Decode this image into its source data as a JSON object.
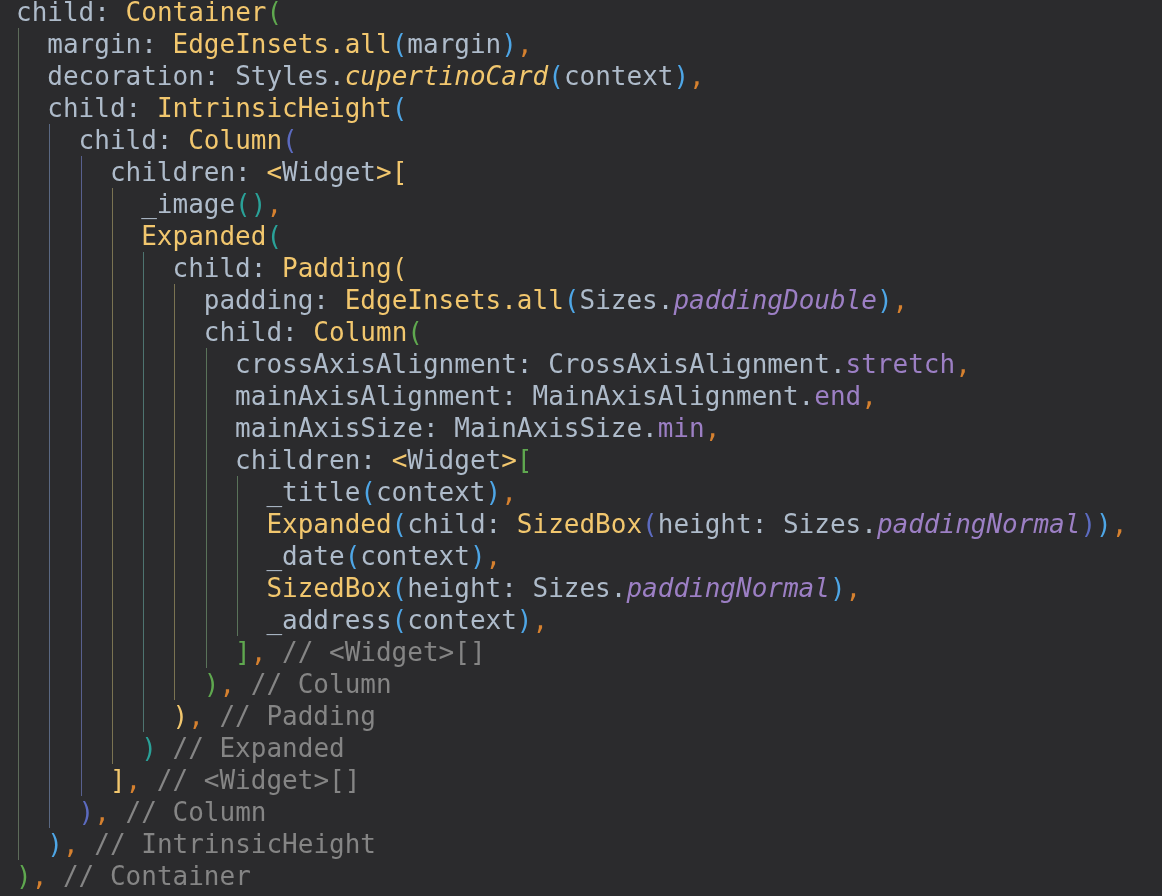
{
  "editor": {
    "lines": [
      {
        "tokens": [
          {
            "kind": "name",
            "text": "child: "
          },
          {
            "kind": "type",
            "text": "Container"
          },
          {
            "kind": "bracket",
            "text": "(",
            "color": "#5fa84f"
          }
        ],
        "children": [
          {
            "tokens": [
              {
                "kind": "name",
                "text": "margin: "
              },
              {
                "kind": "type",
                "text": "EdgeInsets.all"
              },
              {
                "kind": "bracket",
                "text": "(",
                "color": "#4ea6e6"
              },
              {
                "kind": "name",
                "text": "margin"
              },
              {
                "kind": "bracket",
                "text": ")",
                "color": "#4ea6e6"
              },
              {
                "kind": "comma",
                "text": ","
              }
            ]
          },
          {
            "tokens": [
              {
                "kind": "name",
                "text": "decoration: Styles."
              },
              {
                "kind": "static",
                "text": "cupertinoCard"
              },
              {
                "kind": "bracket",
                "text": "(",
                "color": "#4ea6e6"
              },
              {
                "kind": "name",
                "text": "context"
              },
              {
                "kind": "bracket",
                "text": ")",
                "color": "#4ea6e6"
              },
              {
                "kind": "comma",
                "text": ","
              }
            ]
          },
          {
            "tokens": [
              {
                "kind": "name",
                "text": "child: "
              },
              {
                "kind": "type",
                "text": "IntrinsicHeight"
              },
              {
                "kind": "bracket",
                "text": "(",
                "color": "#4ea6e6"
              }
            ],
            "children": [
              {
                "tokens": [
                  {
                    "kind": "name",
                    "text": "child: "
                  },
                  {
                    "kind": "type",
                    "text": "Column"
                  },
                  {
                    "kind": "bracket",
                    "text": "(",
                    "color": "#5c6bc0"
                  }
                ],
                "children": [
                  {
                    "tokens": [
                      {
                        "kind": "name",
                        "text": "children: "
                      },
                      {
                        "kind": "type",
                        "text": "<"
                      },
                      {
                        "kind": "name",
                        "text": "Widget"
                      },
                      {
                        "kind": "type",
                        "text": ">"
                      },
                      {
                        "kind": "bracket",
                        "text": "[",
                        "color": "#f2c76e"
                      }
                    ],
                    "children": [
                      {
                        "tokens": [
                          {
                            "kind": "name",
                            "text": "_image"
                          },
                          {
                            "kind": "bracket",
                            "text": "()",
                            "color": "#2aa198"
                          },
                          {
                            "kind": "comma",
                            "text": ","
                          }
                        ]
                      },
                      {
                        "tokens": [
                          {
                            "kind": "type",
                            "text": "Expanded"
                          },
                          {
                            "kind": "bracket",
                            "text": "(",
                            "color": "#2aa198"
                          }
                        ],
                        "children": [
                          {
                            "tokens": [
                              {
                                "kind": "name",
                                "text": "child: "
                              },
                              {
                                "kind": "type",
                                "text": "Padding"
                              },
                              {
                                "kind": "bracket",
                                "text": "(",
                                "color": "#f2c76e"
                              }
                            ],
                            "children": [
                              {
                                "tokens": [
                                  {
                                    "kind": "name",
                                    "text": "padding: "
                                  },
                                  {
                                    "kind": "type",
                                    "text": "EdgeInsets.all"
                                  },
                                  {
                                    "kind": "bracket",
                                    "text": "(",
                                    "color": "#4ea6e6"
                                  },
                                  {
                                    "kind": "name",
                                    "text": "Sizes."
                                  },
                                  {
                                    "kind": "const",
                                    "text": "paddingDouble"
                                  },
                                  {
                                    "kind": "bracket",
                                    "text": ")",
                                    "color": "#4ea6e6"
                                  },
                                  {
                                    "kind": "comma",
                                    "text": ","
                                  }
                                ]
                              },
                              {
                                "tokens": [
                                  {
                                    "kind": "name",
                                    "text": "child: "
                                  },
                                  {
                                    "kind": "type",
                                    "text": "Column"
                                  },
                                  {
                                    "kind": "bracket",
                                    "text": "(",
                                    "color": "#5fa84f"
                                  }
                                ],
                                "children": [
                                  {
                                    "tokens": [
                                      {
                                        "kind": "name",
                                        "text": "crossAxisAlignment: CrossAxisAlignment."
                                      },
                                      {
                                        "kind": "enum",
                                        "text": "stretch"
                                      },
                                      {
                                        "kind": "comma",
                                        "text": ","
                                      }
                                    ]
                                  },
                                  {
                                    "tokens": [
                                      {
                                        "kind": "name",
                                        "text": "mainAxisAlignment: MainAxisAlignment."
                                      },
                                      {
                                        "kind": "enum",
                                        "text": "end"
                                      },
                                      {
                                        "kind": "comma",
                                        "text": ","
                                      }
                                    ]
                                  },
                                  {
                                    "tokens": [
                                      {
                                        "kind": "name",
                                        "text": "mainAxisSize: MainAxisSize."
                                      },
                                      {
                                        "kind": "enum",
                                        "text": "min"
                                      },
                                      {
                                        "kind": "comma",
                                        "text": ","
                                      }
                                    ]
                                  },
                                  {
                                    "tokens": [
                                      {
                                        "kind": "name",
                                        "text": "children: "
                                      },
                                      {
                                        "kind": "type",
                                        "text": "<"
                                      },
                                      {
                                        "kind": "name",
                                        "text": "Widget"
                                      },
                                      {
                                        "kind": "type",
                                        "text": ">"
                                      },
                                      {
                                        "kind": "bracket",
                                        "text": "[",
                                        "color": "#5fa84f"
                                      }
                                    ],
                                    "children": [
                                      {
                                        "tokens": [
                                          {
                                            "kind": "name",
                                            "text": "_title"
                                          },
                                          {
                                            "kind": "bracket",
                                            "text": "(",
                                            "color": "#4ea6e6"
                                          },
                                          {
                                            "kind": "name",
                                            "text": "context"
                                          },
                                          {
                                            "kind": "bracket",
                                            "text": ")",
                                            "color": "#4ea6e6"
                                          },
                                          {
                                            "kind": "comma",
                                            "text": ","
                                          }
                                        ]
                                      },
                                      {
                                        "tokens": [
                                          {
                                            "kind": "type",
                                            "text": "Expanded"
                                          },
                                          {
                                            "kind": "bracket",
                                            "text": "(",
                                            "color": "#4ea6e6"
                                          },
                                          {
                                            "kind": "name",
                                            "text": "child: "
                                          },
                                          {
                                            "kind": "type",
                                            "text": "SizedBox"
                                          },
                                          {
                                            "kind": "bracket",
                                            "text": "(",
                                            "color": "#5c6bc0"
                                          },
                                          {
                                            "kind": "name",
                                            "text": "height: Sizes."
                                          },
                                          {
                                            "kind": "const",
                                            "text": "paddingNormal"
                                          },
                                          {
                                            "kind": "bracket",
                                            "text": ")",
                                            "color": "#5c6bc0"
                                          },
                                          {
                                            "kind": "bracket",
                                            "text": ")",
                                            "color": "#4ea6e6"
                                          },
                                          {
                                            "kind": "comma",
                                            "text": ","
                                          }
                                        ]
                                      },
                                      {
                                        "tokens": [
                                          {
                                            "kind": "name",
                                            "text": "_date"
                                          },
                                          {
                                            "kind": "bracket",
                                            "text": "(",
                                            "color": "#4ea6e6"
                                          },
                                          {
                                            "kind": "name",
                                            "text": "context"
                                          },
                                          {
                                            "kind": "bracket",
                                            "text": ")",
                                            "color": "#4ea6e6"
                                          },
                                          {
                                            "kind": "comma",
                                            "text": ","
                                          }
                                        ]
                                      },
                                      {
                                        "tokens": [
                                          {
                                            "kind": "type",
                                            "text": "SizedBox"
                                          },
                                          {
                                            "kind": "bracket",
                                            "text": "(",
                                            "color": "#4ea6e6"
                                          },
                                          {
                                            "kind": "name",
                                            "text": "height: Sizes."
                                          },
                                          {
                                            "kind": "const",
                                            "text": "paddingNormal"
                                          },
                                          {
                                            "kind": "bracket",
                                            "text": ")",
                                            "color": "#4ea6e6"
                                          },
                                          {
                                            "kind": "comma",
                                            "text": ","
                                          }
                                        ]
                                      },
                                      {
                                        "tokens": [
                                          {
                                            "kind": "name",
                                            "text": "_address"
                                          },
                                          {
                                            "kind": "bracket",
                                            "text": "(",
                                            "color": "#4ea6e6"
                                          },
                                          {
                                            "kind": "name",
                                            "text": "context"
                                          },
                                          {
                                            "kind": "bracket",
                                            "text": ")",
                                            "color": "#4ea6e6"
                                          },
                                          {
                                            "kind": "comma",
                                            "text": ","
                                          }
                                        ]
                                      }
                                    ]
                                  },
                                  {
                                    "tokens": [
                                      {
                                        "kind": "bracket",
                                        "text": "]",
                                        "color": "#5fa84f"
                                      },
                                      {
                                        "kind": "comma",
                                        "text": ","
                                      },
                                      {
                                        "kind": "comment",
                                        "text": " // <Widget>[]"
                                      }
                                    ]
                                  }
                                ]
                              },
                              {
                                "tokens": [
                                  {
                                    "kind": "bracket",
                                    "text": ")",
                                    "color": "#5fa84f"
                                  },
                                  {
                                    "kind": "comma",
                                    "text": ","
                                  },
                                  {
                                    "kind": "comment",
                                    "text": " // Column"
                                  }
                                ]
                              }
                            ]
                          },
                          {
                            "tokens": [
                              {
                                "kind": "bracket",
                                "text": ")",
                                "color": "#f2c76e"
                              },
                              {
                                "kind": "comma",
                                "text": ","
                              },
                              {
                                "kind": "comment",
                                "text": " // Padding"
                              }
                            ]
                          }
                        ]
                      },
                      {
                        "tokens": [
                          {
                            "kind": "bracket",
                            "text": ")",
                            "color": "#2aa198"
                          },
                          {
                            "kind": "comment",
                            "text": " // Expanded"
                          }
                        ]
                      }
                    ]
                  },
                  {
                    "tokens": [
                      {
                        "kind": "bracket",
                        "text": "]",
                        "color": "#f2c76e"
                      },
                      {
                        "kind": "comma",
                        "text": ","
                      },
                      {
                        "kind": "comment",
                        "text": " // <Widget>[]"
                      }
                    ]
                  }
                ]
              },
              {
                "tokens": [
                  {
                    "kind": "bracket",
                    "text": ")",
                    "color": "#5c6bc0"
                  },
                  {
                    "kind": "comma",
                    "text": ","
                  },
                  {
                    "kind": "comment",
                    "text": " // Column"
                  }
                ]
              }
            ]
          },
          {
            "tokens": [
              {
                "kind": "bracket",
                "text": ")",
                "color": "#4ea6e6"
              },
              {
                "kind": "comma",
                "text": ","
              },
              {
                "kind": "comment",
                "text": " // IntrinsicHeight"
              }
            ]
          }
        ]
      },
      {
        "tokens": [
          {
            "kind": "bracket",
            "text": ")",
            "color": "#5fa84f"
          },
          {
            "kind": "comma",
            "text": ","
          },
          {
            "kind": "comment",
            "text": " // Container"
          }
        ]
      }
    ]
  }
}
